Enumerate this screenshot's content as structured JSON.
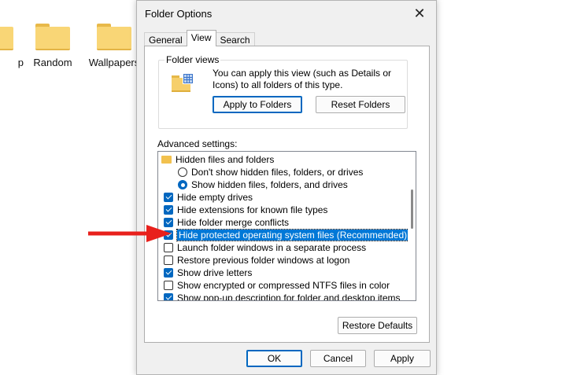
{
  "desktop": {
    "folders": [
      {
        "label": "p"
      },
      {
        "label": "Random"
      },
      {
        "label": "Wallpapers"
      }
    ]
  },
  "dialog": {
    "title": "Folder Options",
    "close_icon": "close-icon",
    "tabs": [
      {
        "label": "General",
        "active": false
      },
      {
        "label": "View",
        "active": true
      },
      {
        "label": "Search",
        "active": false
      }
    ],
    "folder_views": {
      "group_label": "Folder views",
      "description": "You can apply this view (such as Details or Icons) to all folders of this type.",
      "apply_button": "Apply to Folders",
      "reset_button": "Reset Folders"
    },
    "advanced": {
      "label": "Advanced settings:",
      "items": [
        {
          "type": "folder",
          "label": "Hidden files and folders"
        },
        {
          "type": "radio",
          "checked": false,
          "label": "Don't show hidden files, folders, or drives"
        },
        {
          "type": "radio",
          "checked": true,
          "label": "Show hidden files, folders, and drives"
        },
        {
          "type": "checkbox",
          "checked": true,
          "label": "Hide empty drives"
        },
        {
          "type": "checkbox",
          "checked": true,
          "label": "Hide extensions for known file types"
        },
        {
          "type": "checkbox",
          "checked": true,
          "label": "Hide folder merge conflicts"
        },
        {
          "type": "checkbox",
          "checked": true,
          "label": "Hide protected operating system files (Recommended)",
          "selected": true
        },
        {
          "type": "checkbox",
          "checked": false,
          "label": "Launch folder windows in a separate process"
        },
        {
          "type": "checkbox",
          "checked": false,
          "label": "Restore previous folder windows at logon"
        },
        {
          "type": "checkbox",
          "checked": true,
          "label": "Show drive letters"
        },
        {
          "type": "checkbox",
          "checked": false,
          "label": "Show encrypted or compressed NTFS files in color"
        },
        {
          "type": "checkbox",
          "checked": true,
          "label": "Show pop-up description for folder and desktop items"
        }
      ]
    },
    "restore_defaults_button": "Restore Defaults",
    "ok_button": "OK",
    "cancel_button": "Cancel",
    "apply_button": "Apply"
  },
  "colors": {
    "accent": "#0067c0",
    "selection": "#0078d7",
    "arrow": "#e8201c"
  }
}
